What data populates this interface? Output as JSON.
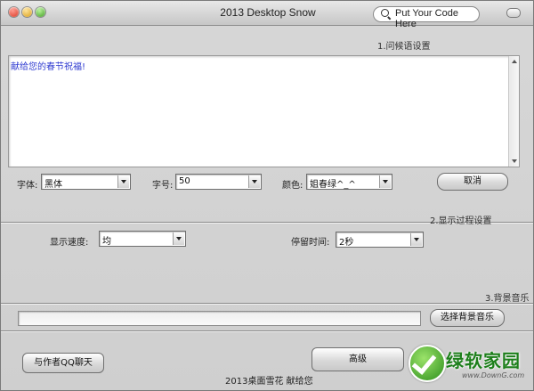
{
  "window": {
    "title": "2013 Desktop Snow"
  },
  "code_search": {
    "label": "Put Your Code Here"
  },
  "section1": {
    "label": "1.问候语设置",
    "greeting_text": "献给您的春节祝福!",
    "font_label": "字体:",
    "font_value": "黑体",
    "size_label": "字号:",
    "size_value": "50",
    "color_label": "颜色:",
    "color_value": "姐春绿^_^",
    "cancel_label": "取消"
  },
  "section2": {
    "label": "2.显示过程设置",
    "speed_label": "显示速度:",
    "speed_value": "均",
    "stay_label": "停留时间:",
    "stay_value": "2秒"
  },
  "section3": {
    "label": "3.背景音乐",
    "music_path": "",
    "choose_label": "选择背景音乐"
  },
  "footer": {
    "chat_label": "与作者QQ聊天",
    "advanced_label": "高级",
    "text": "2013桌面雪花 献给您"
  },
  "watermark": {
    "brand": "绿软家园",
    "url": "www.DownG.com"
  },
  "colors": {
    "window_bg": "#d3d3d3",
    "greeting_text": "#2e3ad0",
    "brand_green": "#1d7f1b"
  }
}
